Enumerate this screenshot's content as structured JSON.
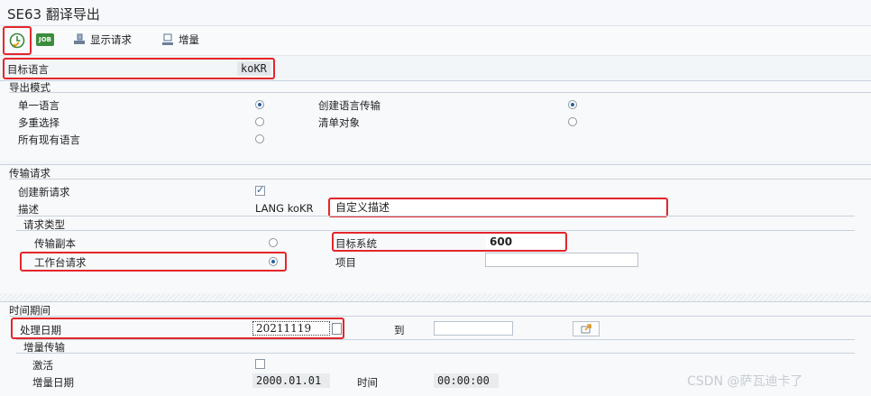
{
  "window": {
    "title": "SE63 翻译导出"
  },
  "toolbar": {
    "execute_icon": "execute-clock-icon",
    "job_label": "JOB",
    "display_request_label": "显示请求",
    "delta_label": "增量"
  },
  "target_language": {
    "label": "目标语言",
    "value": "koKR"
  },
  "export_mode": {
    "title": "导出模式",
    "single_language": "单一语言",
    "multi_select": "多重选择",
    "all_languages": "所有现有语言",
    "create_transport": "创建语言传输",
    "list_objects": "清单对象"
  },
  "transport_request": {
    "title": "传输请求",
    "create_new_label": "创建新请求",
    "create_new_checked": true,
    "description_label": "描述",
    "description_prefix": "LANG koKR",
    "description_value": "自定义描述",
    "request_type": {
      "title": "请求类型",
      "transport_copy": "传输副本",
      "workbench_request": "工作台请求",
      "target_system_label": "目标系统",
      "target_system_value": "600",
      "project_label": "项目",
      "project_value": ""
    }
  },
  "time_period": {
    "title": "时间期间",
    "process_date_label": "处理日期",
    "process_date_value": "20211119",
    "to_label": "到",
    "to_value": "",
    "delta_transport": {
      "title": "增量传输",
      "activate_label": "激活",
      "activate_checked": false,
      "delta_date_label": "增量日期",
      "delta_date_value": "2000.01.01",
      "time_label": "时间",
      "time_value": "00:00:00"
    }
  },
  "watermark": "CSDN @萨瓦迪卡了",
  "colors": {
    "highlight": "#e4262b",
    "accent": "#2b5e9b"
  }
}
